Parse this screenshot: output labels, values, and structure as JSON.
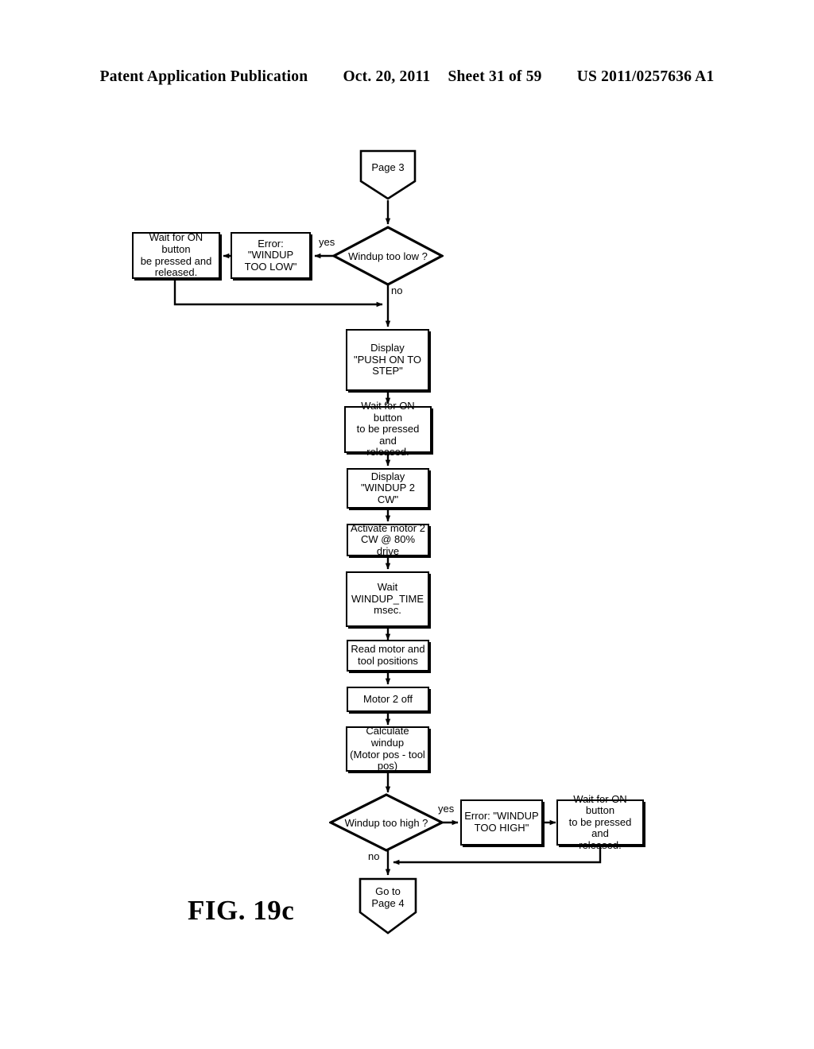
{
  "header": {
    "publication": "Patent Application Publication",
    "date": "Oct. 20, 2011",
    "sheet": "Sheet 31 of 59",
    "docnum": "US 2011/0257636 A1"
  },
  "figure": {
    "caption": "FIG. 19c"
  },
  "colors": {
    "ink": "#000000",
    "paper": "#ffffff"
  },
  "flowchart": {
    "type": "flowchart",
    "nodes": [
      {
        "id": "page3",
        "shape": "connector-pentagon",
        "text": "Page 3"
      },
      {
        "id": "dec_low",
        "shape": "decision",
        "text": "Windup too low ?"
      },
      {
        "id": "err_low",
        "shape": "process",
        "text": "Error: \"WINDUP\nTOO LOW\""
      },
      {
        "id": "wait_low",
        "shape": "process",
        "text": "Wait for ON button\nbe pressed and\nreleased."
      },
      {
        "id": "disp_push",
        "shape": "process",
        "text": "Display\n\"PUSH ON TO\nSTEP\""
      },
      {
        "id": "wait_step",
        "shape": "process",
        "text": "Wait for ON button\nto be pressed and\nreleased."
      },
      {
        "id": "disp_wind",
        "shape": "process",
        "text": "Display\n\"WINDUP 2 CW\""
      },
      {
        "id": "act_motor",
        "shape": "process",
        "text": "Activate motor 2\nCW @ 80% drive"
      },
      {
        "id": "wait_time",
        "shape": "process",
        "text": "Wait\nWINDUP_TIME\nmsec."
      },
      {
        "id": "read_pos",
        "shape": "process",
        "text": "Read motor and\ntool positions"
      },
      {
        "id": "motor_off",
        "shape": "process",
        "text": "Motor 2 off"
      },
      {
        "id": "calc_windup",
        "shape": "process",
        "text": "Calculate windup\n(Motor pos - tool\npos)"
      },
      {
        "id": "dec_high",
        "shape": "decision",
        "text": "Windup too high ?"
      },
      {
        "id": "err_high",
        "shape": "process",
        "text": "Error: \"WINDUP\nTOO HIGH\""
      },
      {
        "id": "wait_high",
        "shape": "process",
        "text": "Wait for ON button\nto be pressed and\nreleased."
      },
      {
        "id": "goto_page4",
        "shape": "connector-pentagon",
        "text": "Go to\nPage 4"
      }
    ],
    "edge_labels": {
      "low_yes": "yes",
      "low_no": "no",
      "high_yes": "yes",
      "high_no": "no"
    }
  }
}
